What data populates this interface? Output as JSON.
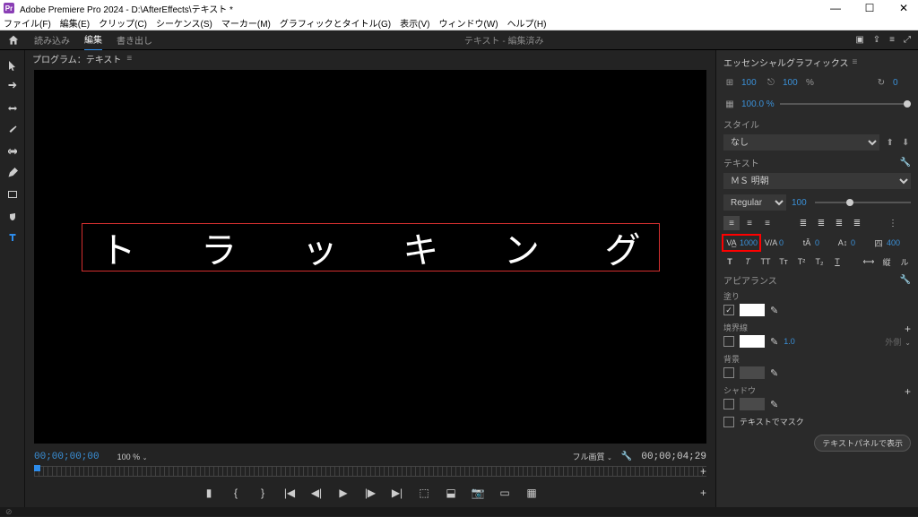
{
  "titlebar": {
    "app_name": "Adobe Premiere Pro 2024",
    "document_path": "D:\\AfterEffects\\テキスト *",
    "icon_label": "Pr"
  },
  "menubar": {
    "items": [
      "ファイル(F)",
      "編集(E)",
      "クリップ(C)",
      "シーケンス(S)",
      "マーカー(M)",
      "グラフィックとタイトル(G)",
      "表示(V)",
      "ウィンドウ(W)",
      "ヘルプ(H)"
    ]
  },
  "topbar": {
    "tabs": [
      "読み込み",
      "編集",
      "書き出し"
    ],
    "active_tab_index": 1,
    "center_text": "テキスト - 編集済み"
  },
  "program": {
    "header": "プログラム：テキスト",
    "canvas_text_chars": [
      "ト",
      "ラ",
      "ッ",
      "キ",
      "ン",
      "グ"
    ],
    "tc_left": "00;00;00;00",
    "zoom_pct": "100 %",
    "fit_label": "フル画質",
    "tc_right": "00;00;04;29"
  },
  "eg": {
    "panel_title": "エッセンシャルグラフィックス",
    "pin_x": "100",
    "pin_y": "100",
    "percent_sign": "%",
    "rotation": "0",
    "opacity": "100.0 %",
    "style_section": "スタイル",
    "style_value": "なし",
    "text_section": "テキスト",
    "font": "ＭＳ 明朝",
    "font_style": "Regular",
    "font_size": "100",
    "tracking_value": "1000",
    "kerning_value": "0",
    "leading_value": "0",
    "baseline_value": "0",
    "tsume_value": "400",
    "appearance_section": "アピアランス",
    "fill_label": "塗り",
    "stroke_label": "境界線",
    "stroke_width": "1.0",
    "stroke_type": "外側",
    "bg_label": "背景",
    "shadow_label": "シャドウ",
    "mask_label": "テキストでマスク",
    "bottom_button": "テキストパネルで表示"
  }
}
